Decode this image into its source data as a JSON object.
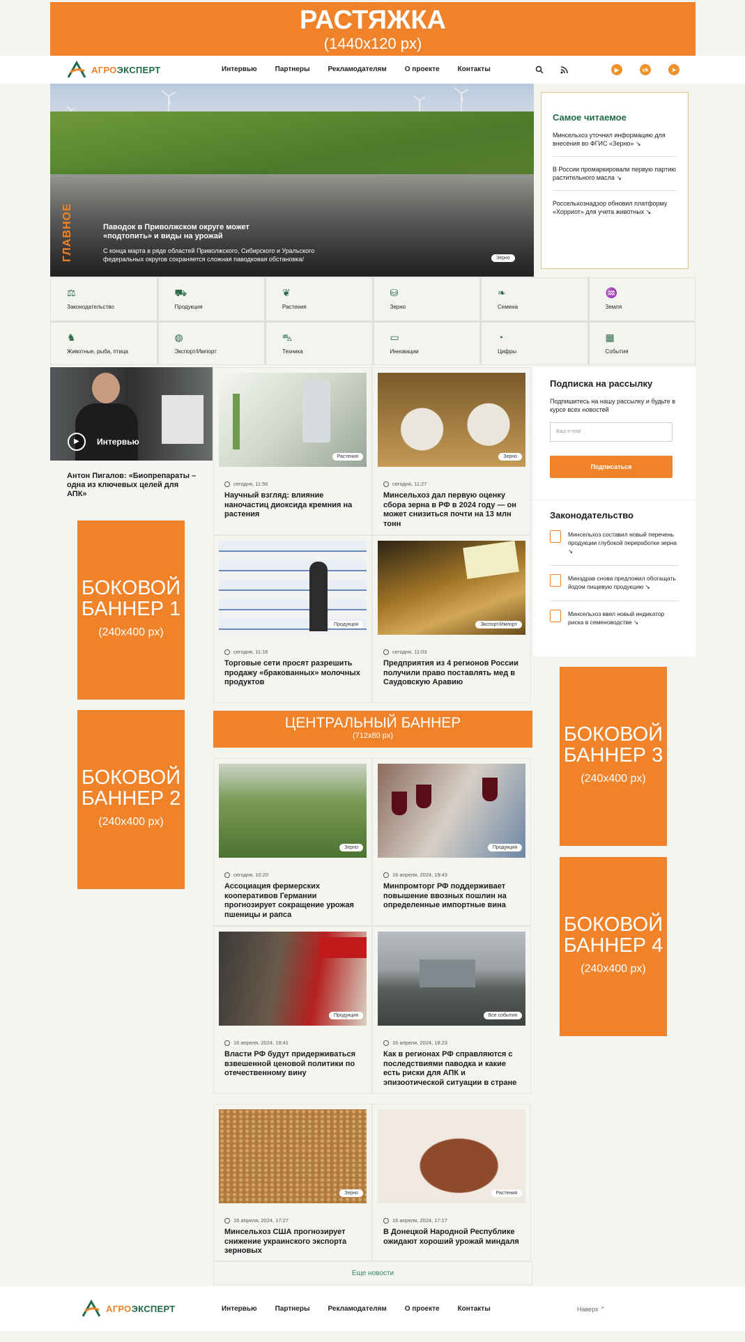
{
  "top_banner": {
    "title": "РАСТЯЖКА",
    "size": "(1440x120 px)"
  },
  "logo": {
    "part1": "АГРО",
    "part2": "ЭКСПЕРТ"
  },
  "nav": [
    "Интервью",
    "Партнеры",
    "Рекламодателям",
    "О проекте",
    "Контакты"
  ],
  "hero": {
    "label": "ГЛАВНОЕ",
    "title": "Паводок в Приволжском округе может «подтопить» и виды на урожай",
    "desc": "С конца марта в ряде областей Приволжского, Сибирского и Уральского федеральных округов сохраняется сложная паводковая обстановка/",
    "tag": "Зерно"
  },
  "popular": {
    "title": "Самое читаемое",
    "items": [
      "Минсельхоз уточнил информацию для внесения во ФГИС «Зерно» ↘",
      "В России промаркировали первую партию растительного масла ↘",
      "Россельхознадзор обновил платформу «Хорриот» для учета животных ↘"
    ]
  },
  "categories": [
    {
      "label": "Законодательство",
      "icon": "⚖"
    },
    {
      "label": "Продукция",
      "icon": "⛟"
    },
    {
      "label": "Растения",
      "icon": "❦"
    },
    {
      "label": "Зерно",
      "icon": "⛁"
    },
    {
      "label": "Семена",
      "icon": "❧"
    },
    {
      "label": "Земля",
      "icon": "♒"
    },
    {
      "label": "Животные, рыба, птица",
      "icon": "♞"
    },
    {
      "label": "Экспорт/Импорт",
      "icon": "◍"
    },
    {
      "label": "Техника",
      "icon": "⛍"
    },
    {
      "label": "Инновации",
      "icon": "▭"
    },
    {
      "label": "Цифры",
      "icon": "◔"
    },
    {
      "label": "События",
      "icon": "▦"
    }
  ],
  "video": {
    "label": "Интервью",
    "title": "Антон Пигалов: «Биопрепараты – одна из ключевых целей для АПК»"
  },
  "side_banners": [
    {
      "title": "БОКОВОЙ БАННЕР 1",
      "size": "(240x400 px)"
    },
    {
      "title": "БОКОВОЙ БАННЕР 2",
      "size": "(240x400 px)"
    },
    {
      "title": "БОКОВОЙ БАННЕР 3",
      "size": "(240x400 px)"
    },
    {
      "title": "БОКОВОЙ БАННЕР 4",
      "size": "(240x400 px)"
    }
  ],
  "news": [
    {
      "tag": "Растения",
      "time": "сегодня, 11:56",
      "title": "Научный взгляд: влияние наночастиц диоксида кремния на растения"
    },
    {
      "tag": "Зерно",
      "time": "сегодня, 11:27",
      "title": "Минсельхоз дал первую оценку сбора зерна в РФ в 2024 году — он может снизиться почти на 13 млн тонн"
    },
    {
      "tag": "Продукция",
      "time": "сегодня, 11:16",
      "title": "Торговые сети просят разрешить продажу «бракованных» молочных продуктов"
    },
    {
      "tag": "Экспорт/Импорт",
      "time": "сегодня, 11:03",
      "title": "Предприятия из 4 регионов России получили право поставлять мед в Саудовскую Аравию"
    },
    {
      "tag": "Зерно",
      "time": "сегодня, 10:20",
      "title": "Ассоциация фермерских кооперативов Германии прогнозирует сокращение урожая пшеницы и рапса"
    },
    {
      "tag": "Продукция",
      "time": "16 апреля, 2024, 19:43",
      "title": "Минпромторг РФ поддерживает повышение ввозных пошлин на определенные импортные вина"
    },
    {
      "tag": "Продукция",
      "time": "16 апреля, 2024, 19:41",
      "title": "Власти РФ будут придерживаться взвешенной ценовой политики по отечественному вину"
    },
    {
      "tag": "Все события",
      "time": "16 апреля, 2024, 18:23",
      "title": "Как в регионах РФ справляются с последствиями паводка и какие есть риски для АПК и эпизоотической ситуации в стране"
    },
    {
      "tag": "Зерно",
      "time": "16 апреля, 2024, 17:27",
      "title": "Минсельхоз США прогнозирует снижение украинского экспорта зерновых"
    },
    {
      "tag": "Растения",
      "time": "16 апреля, 2024, 17:17",
      "title": "В Донецкой Народной Республике ожидают хороший урожай миндаля"
    }
  ],
  "subscribe": {
    "title": "Подписка на рассылку",
    "desc": "Подпишитесь на нашу рассылку и будьте в курсе всех новостей",
    "placeholder": "Ваш e-mail",
    "button": "Подписаться"
  },
  "law": {
    "title": "Законодательство",
    "items": [
      "Минсельхоз составил новый перечень продукции глубокой переработки зерна ↘",
      "Минздрав снова предложил обогащать йодом пищевую продукцию ↘",
      "Минсельхоз ввел новый индикатор риска в семеноводстве ↘"
    ]
  },
  "center_banner": {
    "title": "ЦЕНТРАЛЬНЫЙ БАННЕР",
    "size": "(712x80 px)"
  },
  "more": "Еще новости",
  "footer": {
    "up": "Наверх ⌃"
  },
  "colors": {
    "accent": "#f0822a",
    "brand_green": "#1f6b45"
  }
}
